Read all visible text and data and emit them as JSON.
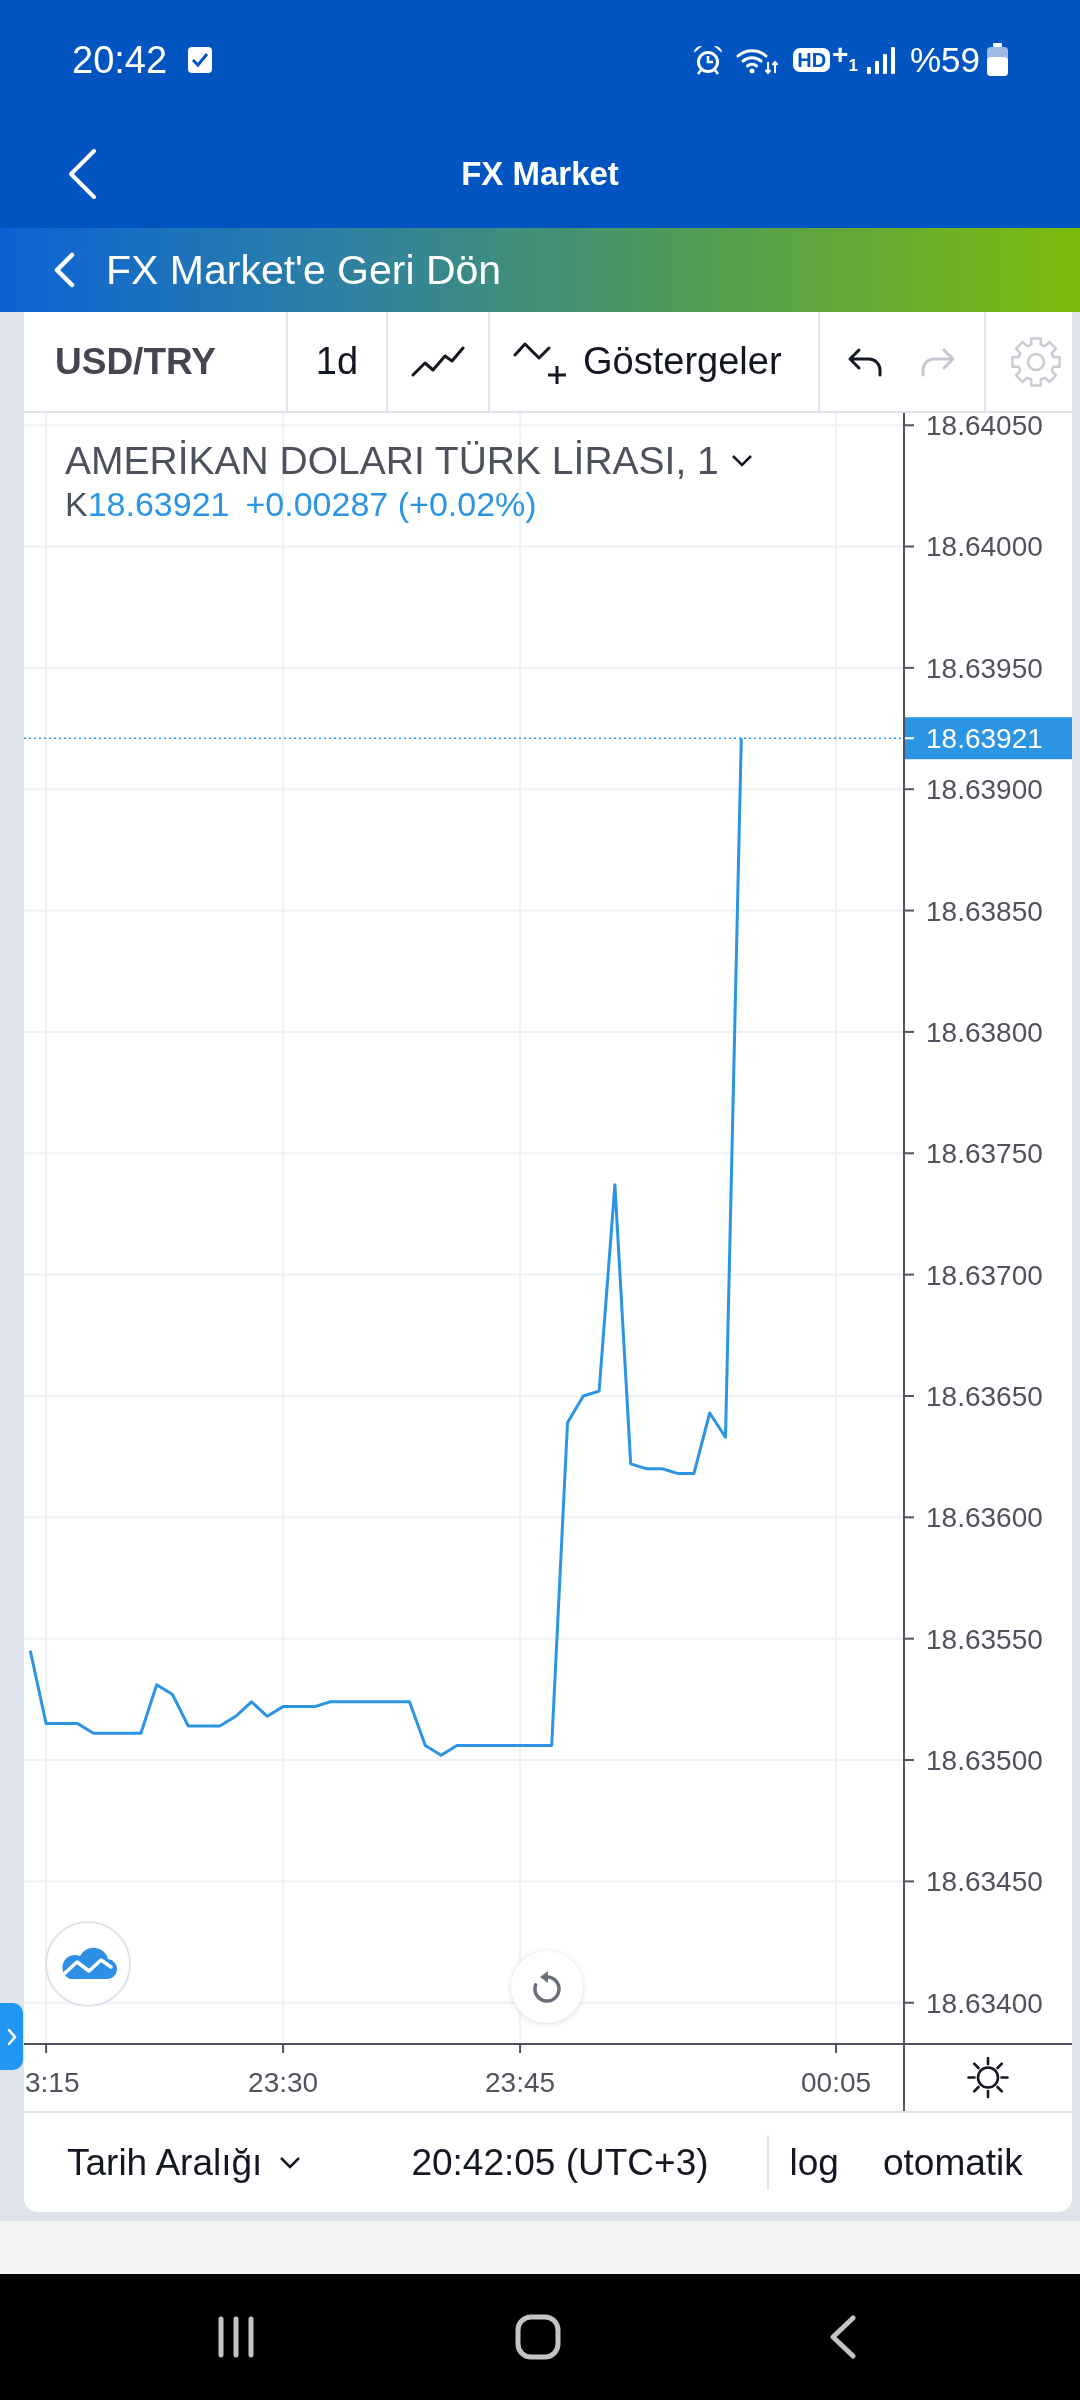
{
  "status_bar": {
    "time": "20:42",
    "hd_label": "HD",
    "sim_label": "+$_{1}$",
    "battery": "%59"
  },
  "app_bar": {
    "title": "FX Market"
  },
  "back_banner": {
    "label": "FX Market'e Geri Dön"
  },
  "toolbar": [
    {
      "kind": "symbol",
      "label": "USD/TRY"
    },
    {
      "kind": "interval",
      "label": "1d"
    },
    {
      "kind": "chart_style"
    },
    {
      "kind": "indicators",
      "label": "Göstergeler"
    },
    {
      "kind": "history",
      "buttons": [
        {
          "kind": "undo",
          "disabled": false
        },
        {
          "kind": "redo",
          "disabled": true
        }
      ]
    },
    {
      "kind": "settings"
    }
  ],
  "chart": {
    "legend": {
      "close_label": "K",
      "close_value": "18.63921",
      "change": "+0.00287 (+0.02%)"
    },
    "chart_data": {
      "type": "line",
      "title": "AMERİKAN DOLARI TÜRK LİRASI, 1",
      "grid": true,
      "categories": [
        null,
        "3:15",
        null,
        null,
        null,
        null,
        null,
        null,
        null,
        null,
        null,
        null,
        null,
        null,
        null,
        null,
        "23:30",
        null,
        null,
        null,
        null,
        null,
        null,
        null,
        null,
        null,
        null,
        null,
        null,
        null,
        null,
        "23:45",
        null,
        null,
        null,
        null,
        null,
        null,
        null,
        null,
        null,
        null,
        null,
        null,
        null,
        null,
        null,
        null,
        null,
        null,
        null,
        "00:05"
      ],
      "series": [
        {
          "color": "#2b95e3",
          "values": [
            18.63545,
            18.63515,
            18.63515,
            18.63515,
            18.63511,
            18.63511,
            18.63511,
            18.63511,
            18.63531,
            18.63527,
            18.63514,
            18.63514,
            18.63514,
            18.63518,
            18.63524,
            18.63518,
            18.63522,
            18.63522,
            18.63522,
            18.63524,
            18.63524,
            18.63524,
            18.63524,
            18.63524,
            18.63524,
            18.63506,
            18.63502,
            18.63506,
            18.63506,
            18.63506,
            18.63506,
            18.63506,
            18.63506,
            18.63506,
            18.63639,
            18.6365,
            18.63652,
            18.63737,
            18.63622,
            18.6362,
            18.6362,
            18.63618,
            18.63618,
            18.63643,
            18.63633,
            18.63921,
            null,
            null,
            null,
            null,
            null,
            null
          ]
        }
      ],
      "ylim": [
        18.63383,
        18.64055
      ],
      "yticks": [
        {
          "value": 18.634,
          "label": "18.63400"
        },
        {
          "value": 18.6345,
          "label": "18.63450"
        },
        {
          "value": 18.635,
          "label": "18.63500"
        },
        {
          "value": 18.6355,
          "label": "18.63550"
        },
        {
          "value": 18.636,
          "label": "18.63600"
        },
        {
          "value": 18.6365,
          "label": "18.63650"
        },
        {
          "value": 18.637,
          "label": "18.63700"
        },
        {
          "value": 18.6375,
          "label": "18.63750"
        },
        {
          "value": 18.638,
          "label": "18.63800"
        },
        {
          "value": 18.6385,
          "label": "18.63850"
        },
        {
          "value": 18.639,
          "label": "18.63900"
        },
        {
          "value": 18.6395,
          "label": "18.63950"
        },
        {
          "value": 18.64,
          "label": "18.64000"
        },
        {
          "value": 18.6405,
          "label": "18.64050"
        }
      ],
      "ref_lines": [
        {
          "axis": "y",
          "value": 18.63921,
          "label": "18.63921"
        }
      ]
    }
  },
  "footer": {
    "date_range": "Tarih Aralığı",
    "clock": "20:42:05 (UTC+3)",
    "log": "log",
    "auto": "otomatik"
  }
}
